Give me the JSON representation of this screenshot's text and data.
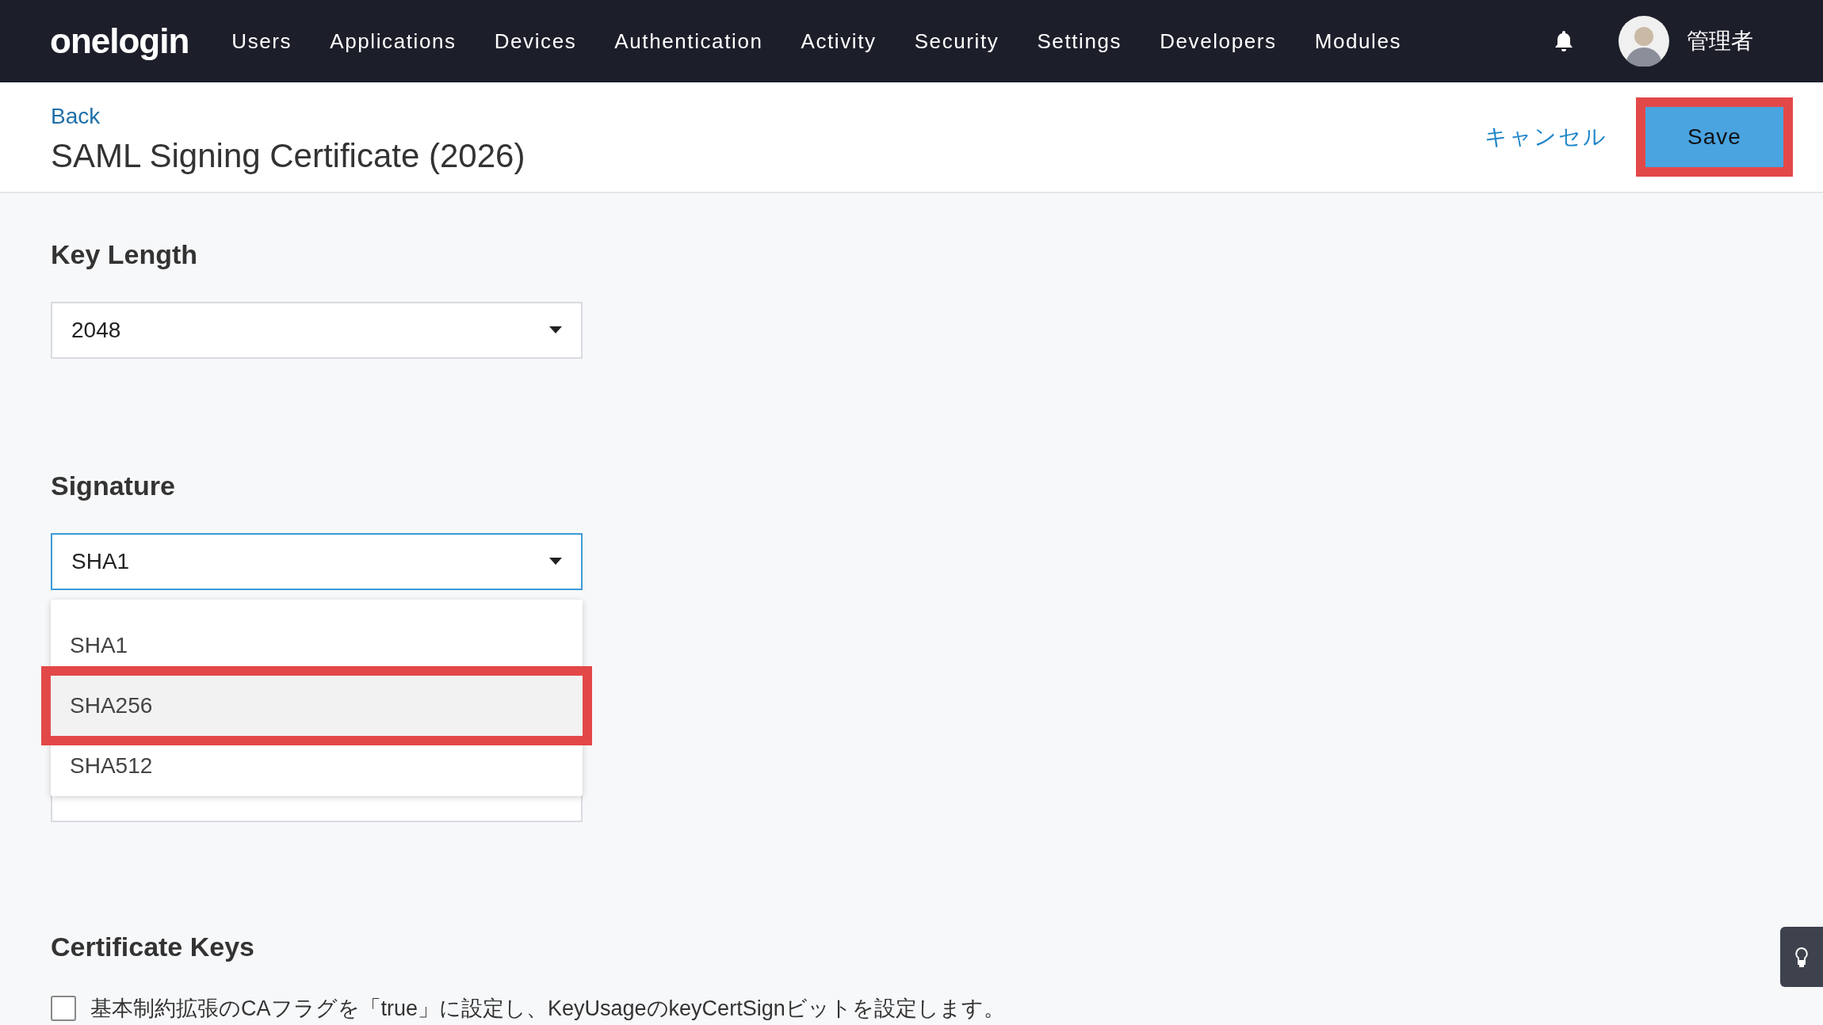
{
  "nav": {
    "logo": "onelogin",
    "items": [
      "Users",
      "Applications",
      "Devices",
      "Authentication",
      "Activity",
      "Security",
      "Settings",
      "Developers",
      "Modules"
    ],
    "user": "管理者"
  },
  "header": {
    "back": "Back",
    "title": "SAML Signing Certificate (2026)",
    "cancel": "キャンセル",
    "save": {
      "label": "Save",
      "highlighted": true
    }
  },
  "sections": [
    {
      "kind": "select",
      "heading": "Key Length",
      "value": "2048",
      "focused": false
    },
    {
      "kind": "select",
      "heading": "Signature",
      "value": "SHA1",
      "focused": true,
      "options": [
        {
          "label": "SHA1",
          "hovered": false,
          "highlighted": false
        },
        {
          "label": "SHA256",
          "hovered": true,
          "highlighted": true
        },
        {
          "label": "SHA512",
          "hovered": false,
          "highlighted": false
        }
      ]
    },
    {
      "kind": "checkbox",
      "heading": "Certificate Keys",
      "label": "基本制約拡張のCAフラグを「true」に設定し、KeyUsageのkeyCertSignビットを設定します。",
      "checked": false
    }
  ]
}
